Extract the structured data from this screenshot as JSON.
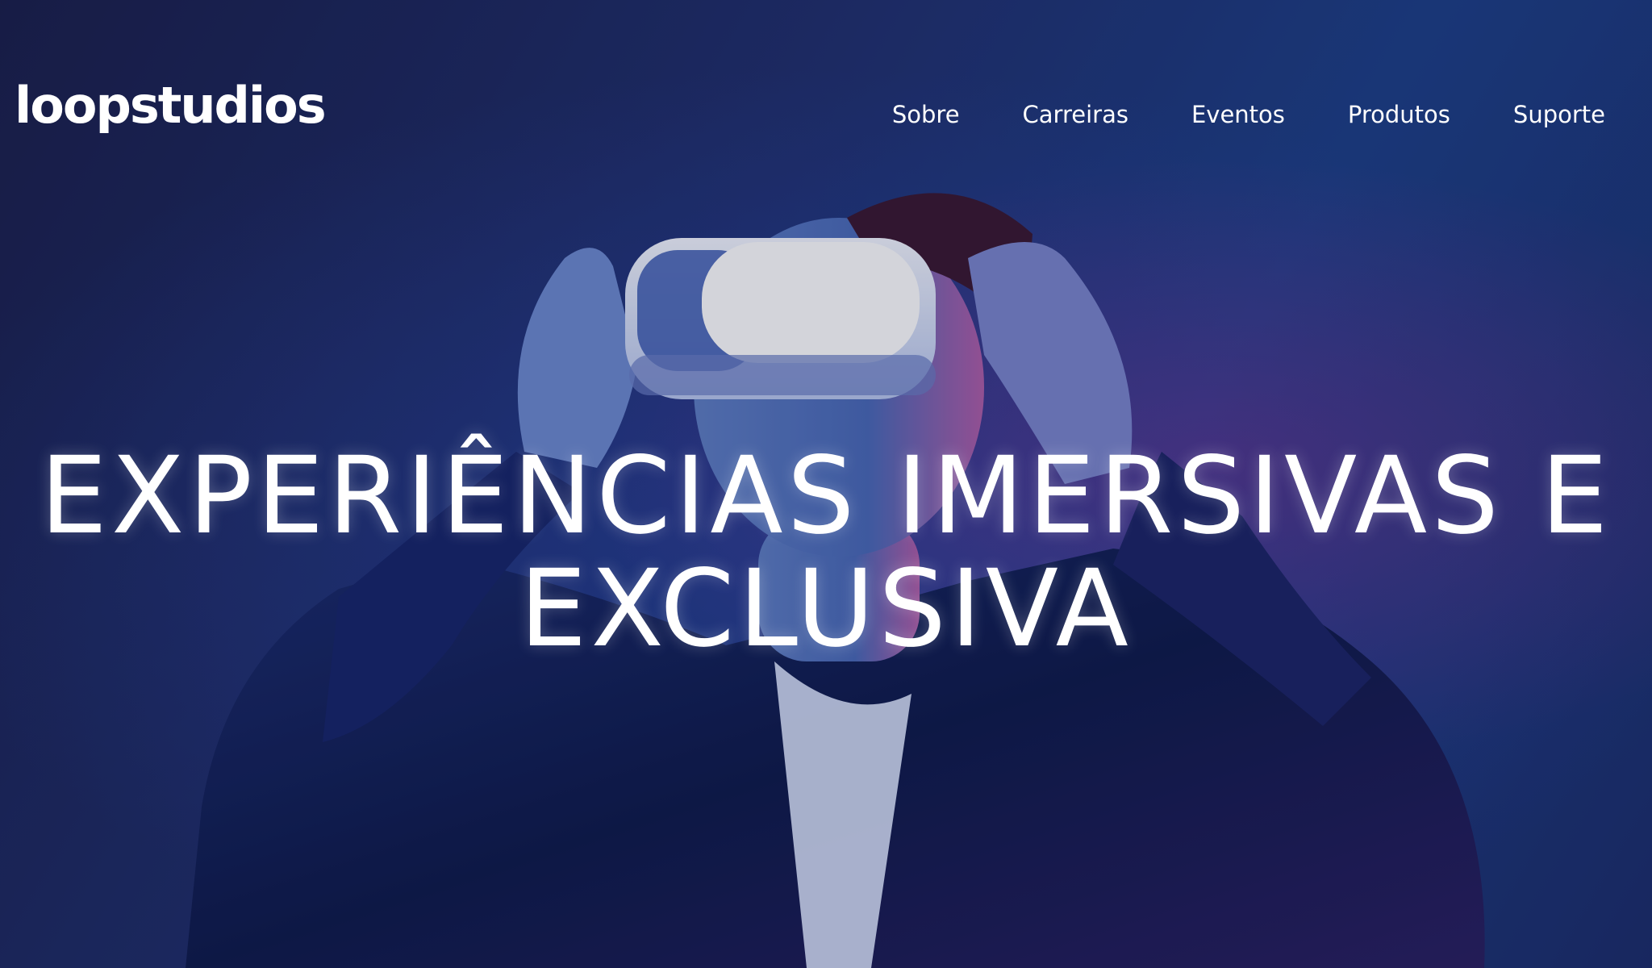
{
  "header": {
    "logo_text": "loopstudios",
    "nav": [
      {
        "label": "Sobre"
      },
      {
        "label": "Carreiras"
      },
      {
        "label": "Eventos"
      },
      {
        "label": "Produtos"
      },
      {
        "label": "Suporte"
      }
    ]
  },
  "hero": {
    "headline_line1": "EXPERIÊNCIAS IMERSIVAS E",
    "headline_line2": "EXCLUSIVA",
    "image_subject": "person-wearing-vr-headset",
    "colors": {
      "background_deep": "#1a1f4a",
      "background_blue": "#1d3f86",
      "accent_magenta": "#aa288c",
      "text": "#ffffff"
    }
  }
}
